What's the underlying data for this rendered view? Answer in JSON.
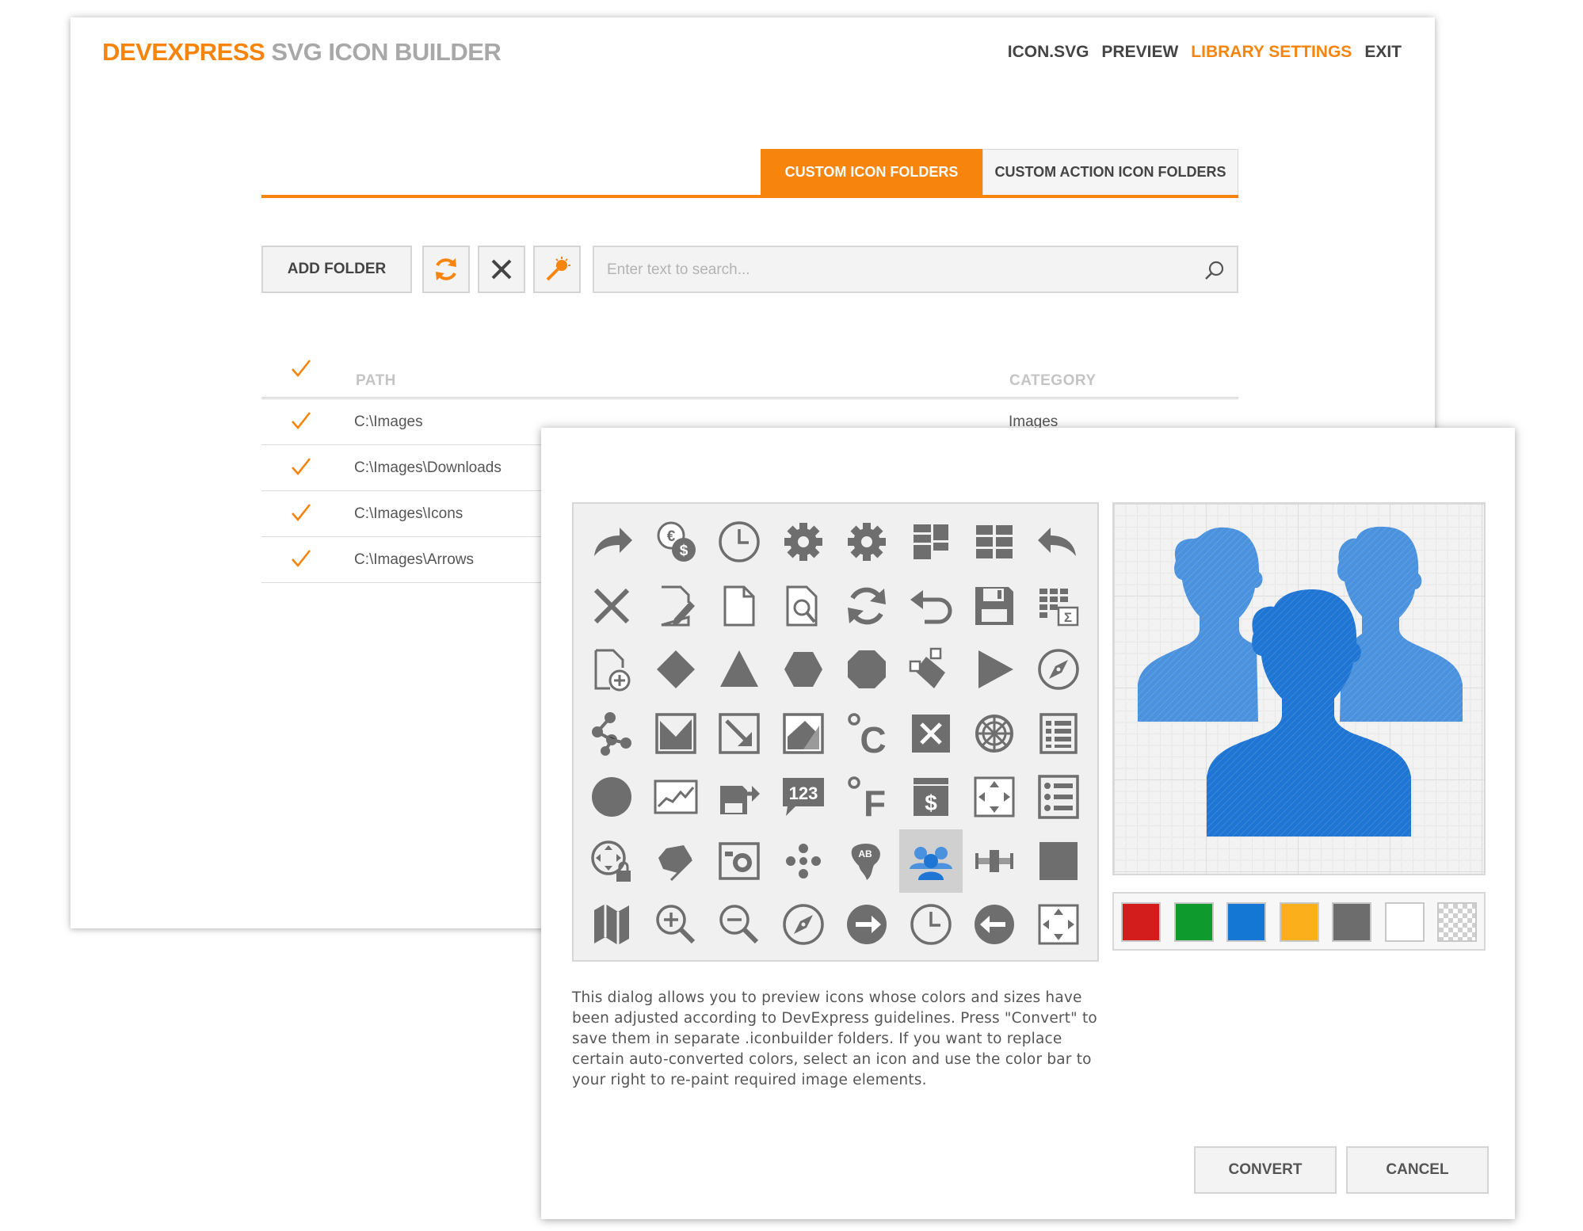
{
  "header": {
    "brand": "DEVEXPRESS",
    "title": "SVG ICON BUILDER",
    "nav": [
      "ICON.SVG",
      "PREVIEW",
      "LIBRARY SETTINGS",
      "EXIT"
    ],
    "active_nav": "LIBRARY SETTINGS"
  },
  "tabs": {
    "custom_icon_folders": "CUSTOM ICON FOLDERS",
    "custom_action_icon_folders": "CUSTOM ACTION ICON FOLDERS"
  },
  "toolbar": {
    "add_folder": "ADD FOLDER",
    "refresh_icon": "refresh-icon",
    "remove_icon": "close-icon",
    "convert_icon": "magic-wand-icon",
    "search_placeholder": "Enter text to search...",
    "search_value": ""
  },
  "grid": {
    "columns": {
      "path": "PATH",
      "category": "CATEGORY"
    },
    "rows": [
      {
        "checked": true,
        "path": "C:\\Images",
        "category": "Images"
      },
      {
        "checked": true,
        "path": "C:\\Images\\Downloads",
        "category": ""
      },
      {
        "checked": true,
        "path": "C:\\Images\\Icons",
        "category": ""
      },
      {
        "checked": true,
        "path": "C:\\Images\\Arrows",
        "category": ""
      }
    ]
  },
  "dialog": {
    "icons": [
      "redo-arrow-icon",
      "currency-exchange-icon",
      "clock-icon",
      "gear-icon",
      "gear-icon",
      "dashboard-layout-icon",
      "grid-layout-icon",
      "undo-arrow-icon",
      "close-icon",
      "edit-document-icon",
      "blank-document-icon",
      "document-search-icon",
      "refresh-icon",
      "undo-icon",
      "save-icon",
      "table-sum-icon",
      "new-document-icon",
      "diamond-icon",
      "triangle-icon",
      "hexagon-icon",
      "octagon-icon",
      "edit-shape-icon",
      "play-icon",
      "compass-icon",
      "nodes-icon",
      "image-frame-icon",
      "resize-icon",
      "image-icon",
      "celsius-icon",
      "delete-icon",
      "wheel-icon",
      "list-icon",
      "circle-icon",
      "line-chart-icon",
      "export-icon",
      "number-callout-icon",
      "fahrenheit-icon",
      "currency-icon",
      "fit-icon",
      "bullet-list-icon",
      "lock-navigation-icon",
      "edit-pencil-icon",
      "photo-icon",
      "dots-icon",
      "map-label-icon",
      "users-icon",
      "slider-icon",
      "square-icon",
      "map-icon",
      "zoom-in-icon",
      "zoom-out-icon",
      "compass-icon",
      "arrow-right-icon",
      "clock-icon",
      "arrow-left-icon",
      "fit-icon"
    ],
    "selected_icon": "users-icon",
    "preview_icon": "users-icon",
    "colors": [
      "#d31c1c",
      "#0e9a2d",
      "#1577d4",
      "#fbb01b",
      "#6d6d6d",
      "#ffffff",
      "transparent"
    ],
    "description": "This dialog allows you to preview icons whose colors and sizes have been adjusted according to DevExpress guidelines. Press \"Convert\" to save them in separate .iconbuilder folders. If you want to replace certain auto-converted colors, select an icon and use the color bar to your right to re-paint required image elements.",
    "convert": "CONVERT",
    "cancel": "CANCEL"
  },
  "colors": {
    "accent": "#f7850d",
    "icon_gray": "#6e6e6e",
    "selection_blue": "#1f75d3"
  }
}
